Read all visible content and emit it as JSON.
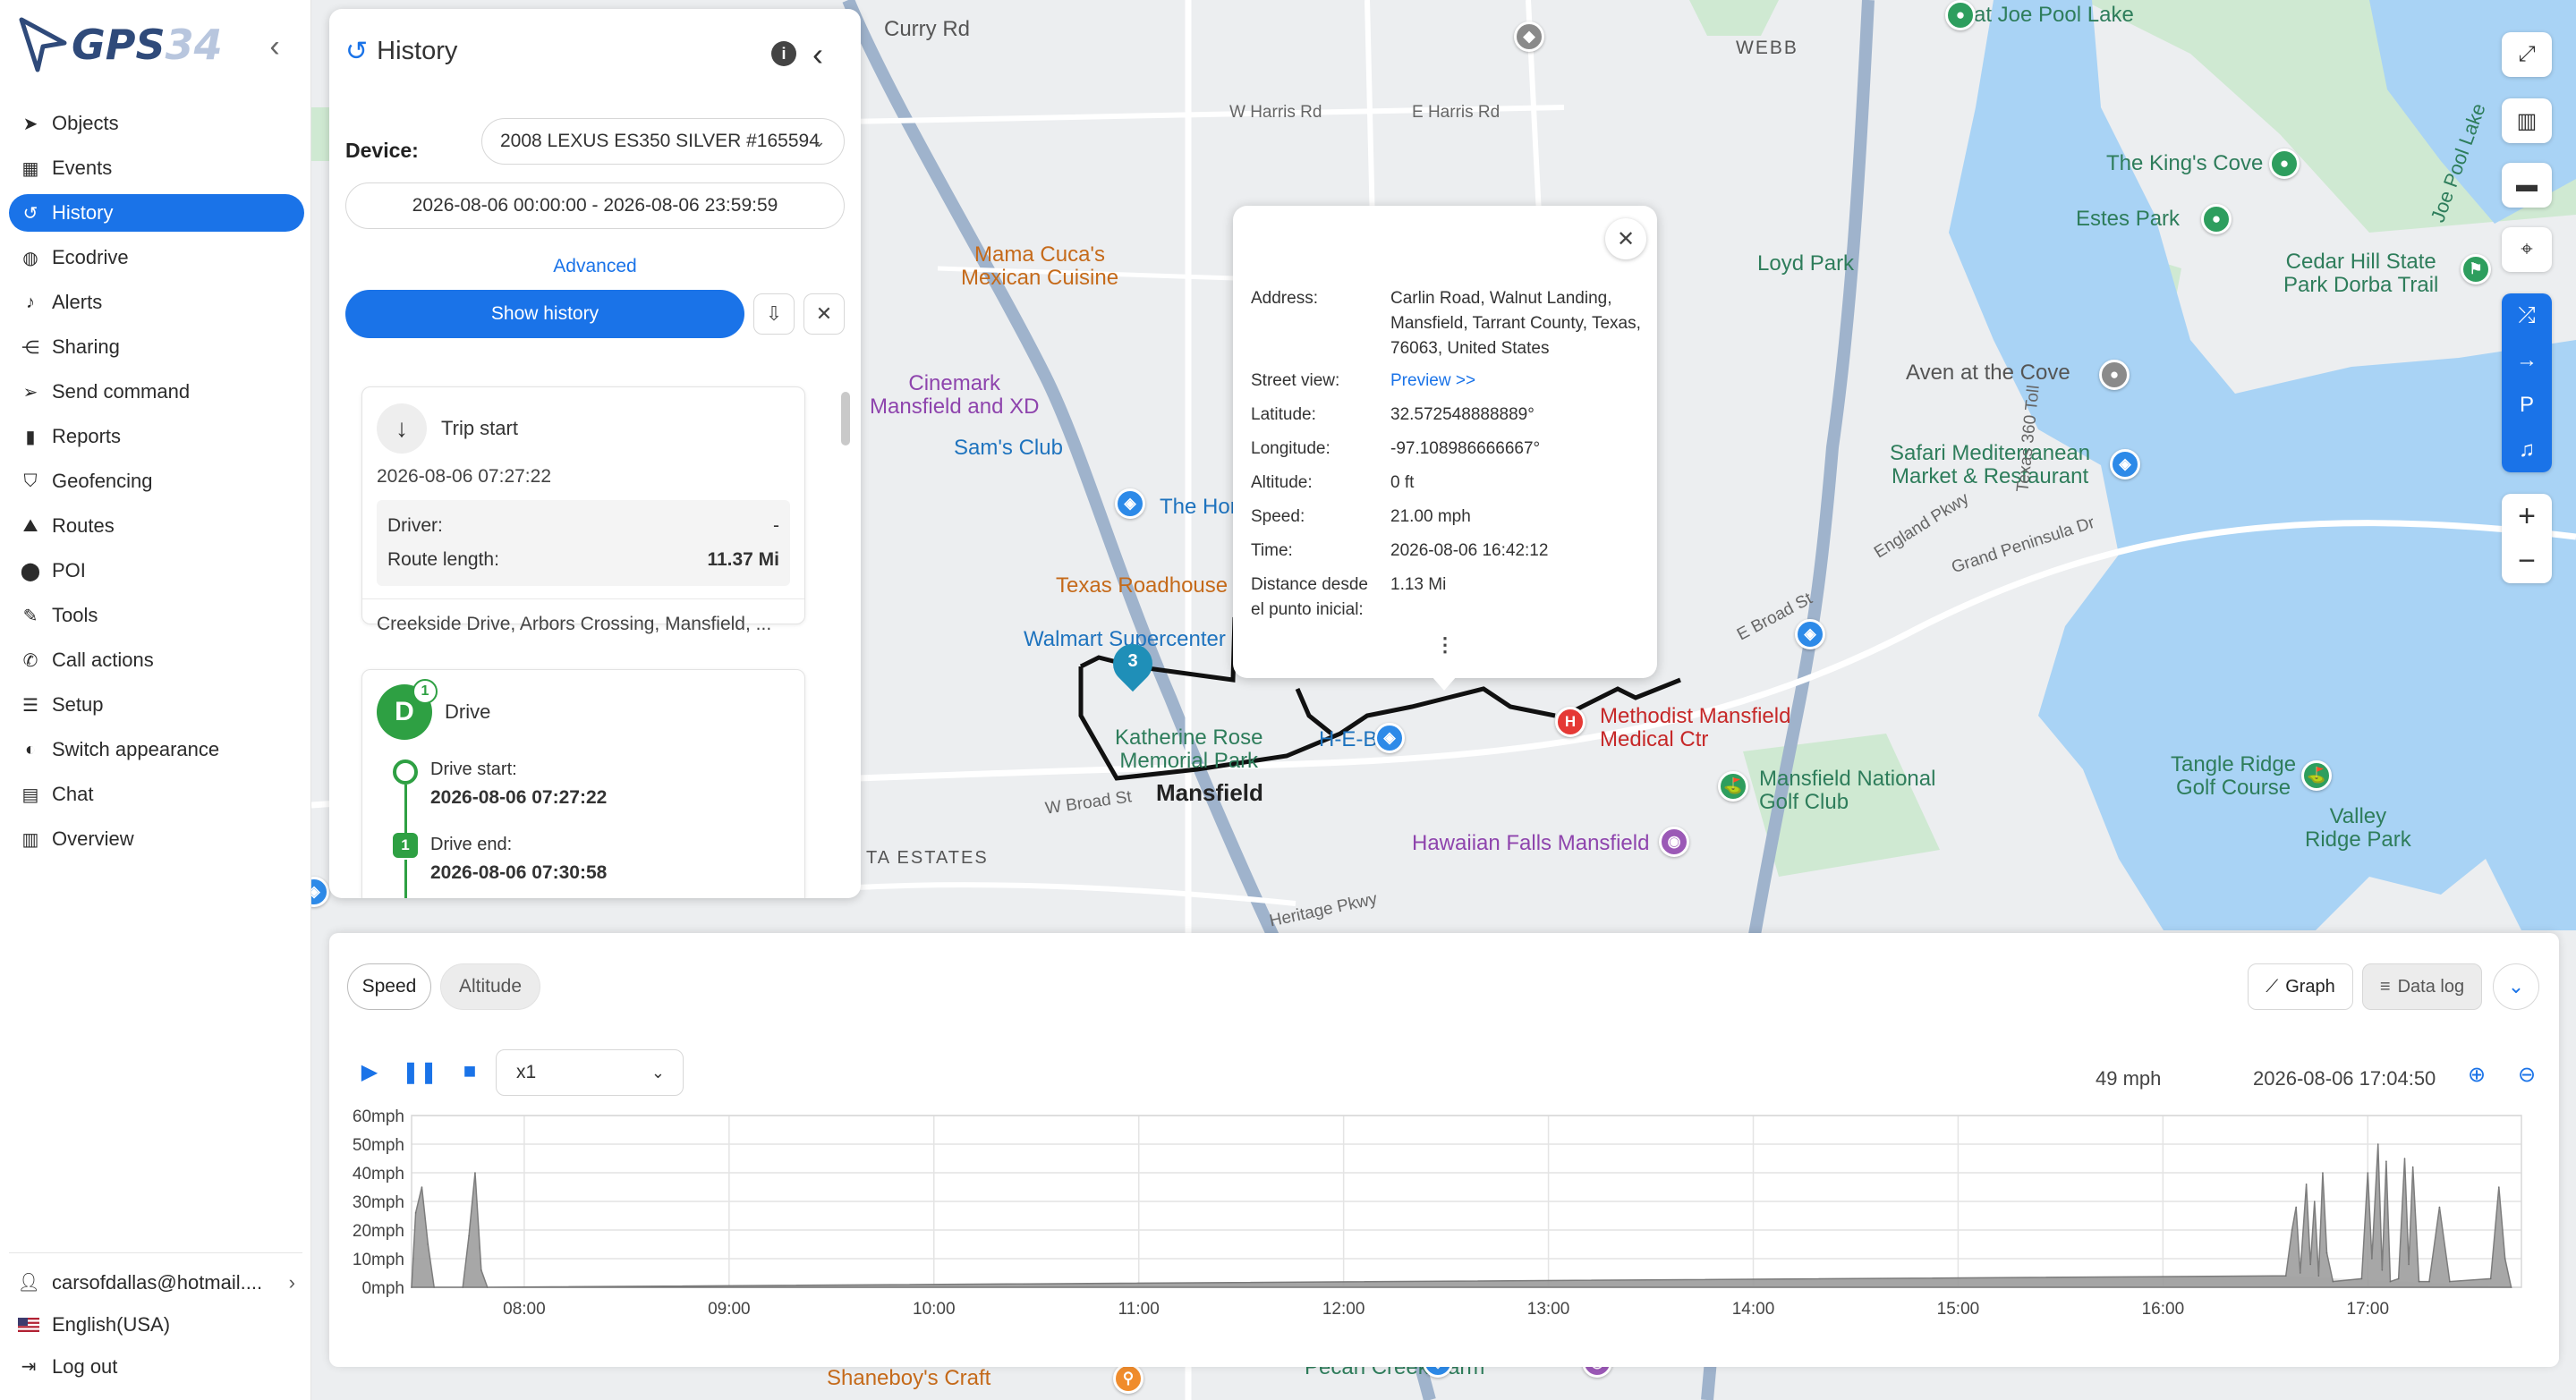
{
  "app": {
    "logo_text_main": "GPS",
    "logo_text_num": "34"
  },
  "sidebar": {
    "items": [
      {
        "label": "Objects",
        "icon": "navigation-arrow-icon",
        "glyph": "➤"
      },
      {
        "label": "Events",
        "icon": "calendar-icon",
        "glyph": "▦"
      },
      {
        "label": "History",
        "icon": "history-icon",
        "glyph": "↺",
        "active": true
      },
      {
        "label": "Ecodrive",
        "icon": "leaf-icon",
        "glyph": "◍"
      },
      {
        "label": "Alerts",
        "icon": "bell-icon",
        "glyph": "♪"
      },
      {
        "label": "Sharing",
        "icon": "share-icon",
        "glyph": "⋲"
      },
      {
        "label": "Send command",
        "icon": "send-icon",
        "glyph": "➢"
      },
      {
        "label": "Reports",
        "icon": "bar-chart-icon",
        "glyph": "▮"
      },
      {
        "label": "Geofencing",
        "icon": "geofence-icon",
        "glyph": "⛉"
      },
      {
        "label": "Routes",
        "icon": "routes-icon",
        "glyph": "⛰"
      },
      {
        "label": "POI",
        "icon": "map-pin-icon",
        "glyph": "⬤"
      },
      {
        "label": "Tools",
        "icon": "wrench-icon",
        "glyph": "✎"
      },
      {
        "label": "Call actions",
        "icon": "phone-icon",
        "glyph": "✆"
      },
      {
        "label": "Setup",
        "icon": "sliders-icon",
        "glyph": "☰"
      },
      {
        "label": "Switch appearance",
        "icon": "palette-icon",
        "glyph": "◐"
      },
      {
        "label": "Chat",
        "icon": "chat-icon",
        "glyph": "▤"
      },
      {
        "label": "Overview",
        "icon": "overview-icon",
        "glyph": "▥"
      }
    ],
    "footer": {
      "user": "carsofdallas@hotmail....",
      "language": "English(USA)",
      "logout": "Log out"
    }
  },
  "history_panel": {
    "title": "History",
    "device_label": "Device:",
    "device_value": "2008 LEXUS ES350 SILVER #165594",
    "date_range": "2026-08-06 00:00:00 - 2026-08-06 23:59:59",
    "advanced_link": "Advanced",
    "show_button": "Show history",
    "trip_start": {
      "title": "Trip start",
      "datetime": "2026-08-06 07:27:22",
      "driver_label": "Driver:",
      "driver_value": "-",
      "route_length_label": "Route length:",
      "route_length_value": "11.37 Mi",
      "address": "Creekside Drive, Arbors Crossing, Mansfield, ..."
    },
    "drive": {
      "letter": "D",
      "badge": "1",
      "title": "Drive",
      "start_label": "Drive start:",
      "start_value": "2026-08-06 07:27:22",
      "end_badge": "1",
      "end_label": "Drive end:",
      "end_value": "2026-08-06 07:30:58"
    }
  },
  "popup": {
    "address_label": "Address:",
    "address_value": "Carlin Road, Walnut Landing, Mansfield, Tarrant County, Texas, 76063, United States",
    "street_view_label": "Street view:",
    "street_view_link": "Preview >>",
    "latitude_label": "Latitude:",
    "latitude_value": "32.572548888889°",
    "longitude_label": "Longitude:",
    "longitude_value": "-97.108986666667°",
    "altitude_label": "Altitude:",
    "altitude_value": "0 ft",
    "speed_label": "Speed:",
    "speed_value": "21.00 mph",
    "time_label": "Time:",
    "time_value": "2026-08-06 16:42:12",
    "distance_label_1": "Distance desde",
    "distance_label_2": "el punto inicial:",
    "distance_value": "1.13 Mi",
    "more": "⋮"
  },
  "map": {
    "labels": {
      "curry_rd": "Curry Rd",
      "webb": "WEBB",
      "joe_pool_lake": "at Joe Pool Lake",
      "joe_pool_lake_water": "Joe Pool Lake",
      "harris_w": "W Harris Rd",
      "harris_e": "E Harris Rd",
      "kings_cove": "The King's Cove",
      "estes_park": "Estes Park",
      "loyd_park": "Loyd Park",
      "cedar_hill": "Cedar Hill State\nPark Dorba Trail",
      "mama_cucas": "Mama Cuca's\nMexican Cuisine",
      "cinemark": "Cinemark\nMansfield and XD",
      "sams_club": "Sam's Club",
      "the_home": "The Hor",
      "texas_roadhouse": "Texas Roadhouse",
      "walmart": "Walmart Supercenter",
      "katherine_rose": "Katherine Rose\nMemorial Park",
      "heb": "H-E-B",
      "mansfield": "Mansfield",
      "methodist": "Methodist Mansfield\nMedical Ctr",
      "mansfield_national": "Mansfield National\nGolf Club",
      "hawaiian_falls": "Hawaiian Falls Mansfield",
      "aven_cove": "Aven at the Cove",
      "safari": "Safari Mediterranean\nMarket & Restaurant",
      "tangle_ridge": "Tangle Ridge\nGolf Course",
      "valley_ridge": "Valley\nRidge Park",
      "ta_estates": "TA ESTATES",
      "w_broad": "W Broad St",
      "e_broad": "E Broad St",
      "heritage": "Heritage Pkwy",
      "england": "England Pkwy",
      "grand_peninsula": "Grand Peninsula Dr",
      "texas360": "Texas 360 Toll",
      "shaneboy": "Shaneboy's Craft",
      "pecan_creek": "Pecan Creek Farm",
      "marker_3": "3"
    }
  },
  "bottom_panel": {
    "tabs": [
      "Speed",
      "Altitude"
    ],
    "graph_button": "Graph",
    "datalog_button": "Data log",
    "speed_multiplier": "x1",
    "current_speed": "49 mph",
    "current_time": "2026-08-06 17:04:50"
  },
  "chart_data": {
    "type": "area",
    "title": "",
    "xlabel": "",
    "ylabel": "",
    "y_ticks": [
      "0mph",
      "10mph",
      "20mph",
      "30mph",
      "40mph",
      "50mph",
      "60mph"
    ],
    "ylim": [
      0,
      60
    ],
    "x_ticks": [
      "08:00",
      "09:00",
      "10:00",
      "11:00",
      "12:00",
      "13:00",
      "14:00",
      "15:00",
      "16:00",
      "17:00"
    ],
    "xlim_hours": [
      7.45,
      17.75
    ],
    "grid": true,
    "color": "#9e9e9e",
    "series": [
      {
        "points": [
          [
            7.45,
            0
          ],
          [
            7.47,
            26
          ],
          [
            7.5,
            35
          ],
          [
            7.53,
            15
          ],
          [
            7.56,
            0
          ],
          [
            7.7,
            0
          ],
          [
            7.73,
            18
          ],
          [
            7.76,
            40
          ],
          [
            7.79,
            6
          ],
          [
            7.82,
            0
          ],
          [
            16.6,
            4
          ],
          [
            16.63,
            20
          ],
          [
            16.65,
            28
          ],
          [
            16.67,
            5
          ],
          [
            16.7,
            36
          ],
          [
            16.72,
            8
          ],
          [
            16.74,
            30
          ],
          [
            16.76,
            4
          ],
          [
            16.78,
            40
          ],
          [
            16.8,
            12
          ],
          [
            16.83,
            2
          ],
          [
            16.97,
            3
          ],
          [
            17.0,
            40
          ],
          [
            17.02,
            10
          ],
          [
            17.05,
            50
          ],
          [
            17.07,
            6
          ],
          [
            17.09,
            44
          ],
          [
            17.11,
            2
          ],
          [
            17.15,
            3
          ],
          [
            17.18,
            45
          ],
          [
            17.2,
            8
          ],
          [
            17.22,
            42
          ],
          [
            17.25,
            2
          ],
          [
            17.3,
            2
          ],
          [
            17.35,
            28
          ],
          [
            17.4,
            2
          ],
          [
            17.6,
            3
          ],
          [
            17.64,
            35
          ],
          [
            17.67,
            10
          ],
          [
            17.7,
            0
          ]
        ]
      }
    ]
  }
}
